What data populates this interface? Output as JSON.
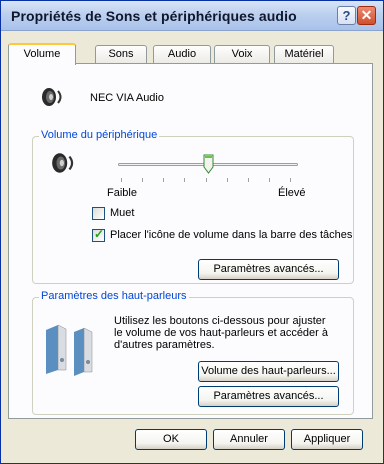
{
  "window": {
    "title": "Propriétés de Sons et périphériques audio",
    "help_glyph": "?",
    "close_glyph": "✕"
  },
  "tabs": [
    {
      "label": "Volume",
      "active": true
    },
    {
      "label": "Sons",
      "active": false
    },
    {
      "label": "Audio",
      "active": false
    },
    {
      "label": "Voix",
      "active": false
    },
    {
      "label": "Matériel",
      "active": false
    }
  ],
  "device": {
    "name": "NEC VIA Audio",
    "icon": "speaker-volume-icon"
  },
  "device_volume": {
    "group_label": "Volume du périphérique",
    "slider_min_label": "Faible",
    "slider_max_label": "Élevé",
    "slider_value_fraction": 0.5,
    "mute_label": "Muet",
    "mute_checked": false,
    "tray_icon_label": "Placer l'icône de volume dans la barre des tâches",
    "tray_icon_checked": true,
    "advanced_button": "Paramètres avancés..."
  },
  "speakers": {
    "group_label": "Paramètres des haut-parleurs",
    "description": "Utilisez les boutons ci-dessous pour ajuster le volume de vos haut-parleurs et accéder à d'autres paramètres.",
    "volume_button": "Volume des haut-parleurs...",
    "advanced_button": "Paramètres avancés..."
  },
  "dialog_buttons": {
    "ok": "OK",
    "cancel": "Annuler",
    "apply": "Appliquer"
  },
  "colors": {
    "tab_highlight": "#ffc73c",
    "group_label": "#0046d5",
    "title_bar": "#bcd0ef",
    "button_border": "#003c74"
  }
}
